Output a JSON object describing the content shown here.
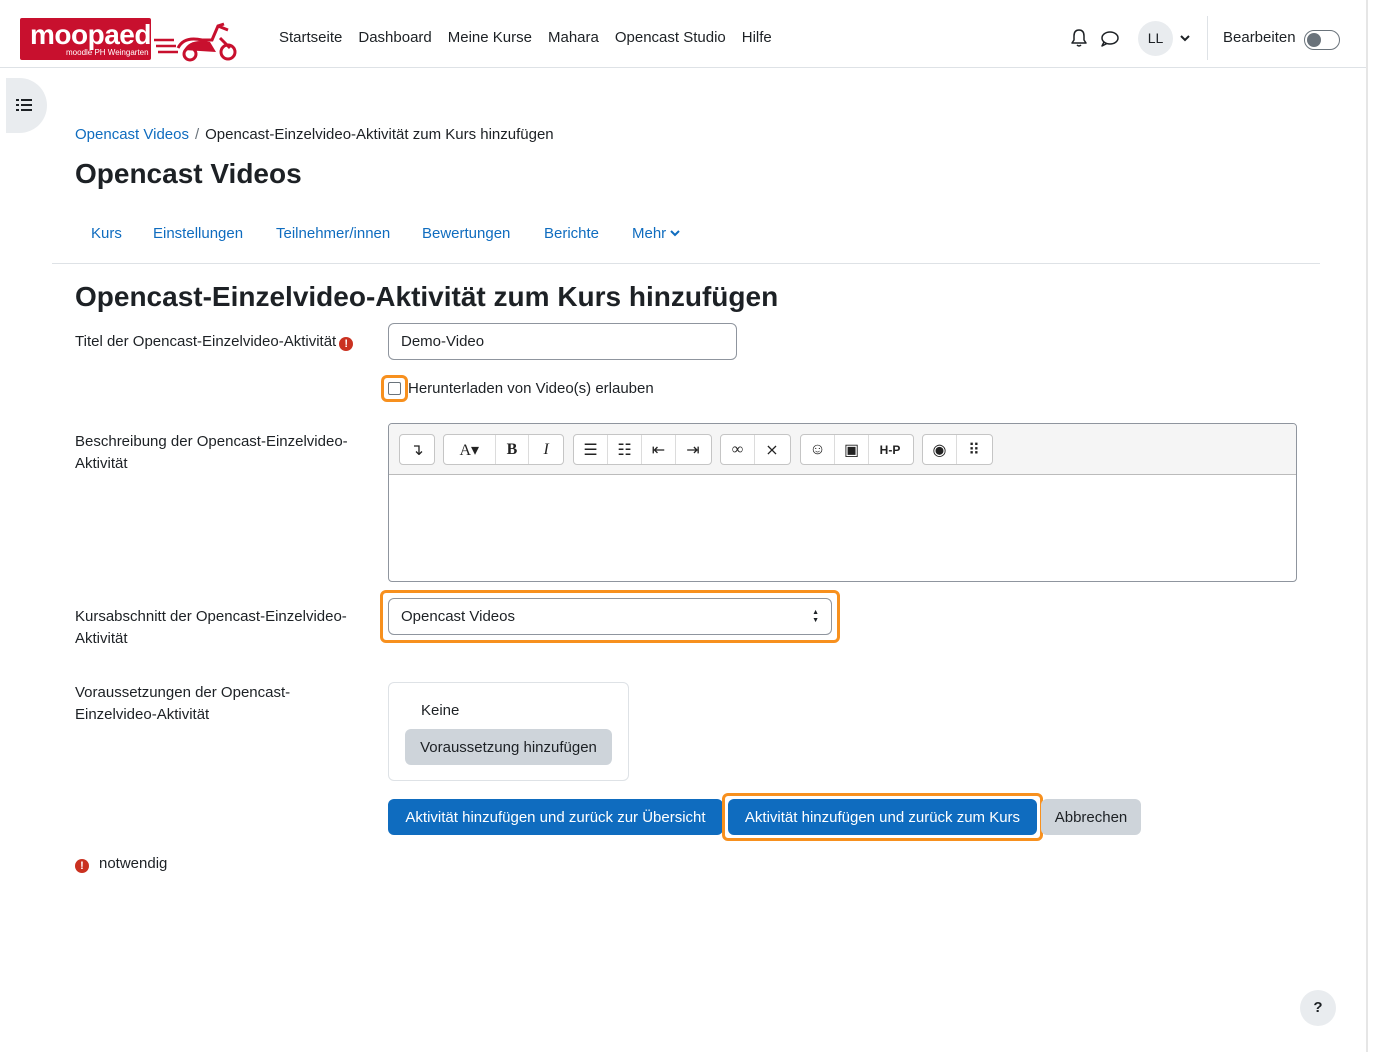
{
  "brand": {
    "logo_text": "moopaed",
    "logo_subtitle": "moodle PH Weingarten"
  },
  "navbar": {
    "items": [
      "Startseite",
      "Dashboard",
      "Meine Kurse",
      "Mahara",
      "Opencast Studio",
      "Hilfe"
    ],
    "avatar_initials": "LL",
    "edit_mode_label": "Bearbeiten",
    "edit_mode_on": false
  },
  "breadcrumb": {
    "parent": "Opencast Videos",
    "separator": "/",
    "current": "Opencast-Einzelvideo-Aktivität zum Kurs hinzufügen"
  },
  "page_title": "Opencast Videos",
  "secondary_nav": [
    "Kurs",
    "Einstellungen",
    "Teilnehmer/innen",
    "Bewertungen",
    "Berichte",
    "Mehr"
  ],
  "form": {
    "heading": "Opencast-Einzelvideo-Aktivität zum Kurs hinzufügen",
    "title_label": "Titel der Opencast-Einzelvideo-Aktivität",
    "title_value": "Demo-Video",
    "download_label": "Herunterladen von Video(s) erlauben",
    "download_checked": false,
    "description_label": "Beschreibung der Opencast-Einzelvideo-Aktivität",
    "section_label": "Kursabschnitt der Opencast-Einzelvideo-Aktivität",
    "section_value": "Opencast Videos",
    "restrictions_label": "Voraussetzungen der Opencast-Einzelvideo-Aktivität",
    "restrictions_none": "Keine",
    "add_restriction_button": "Voraussetzung hinzufügen",
    "submit_display": "Aktivität hinzufügen und zurück zur Übersicht",
    "submit_return": "Aktivität hinzufügen und zurück zum Kurs",
    "cancel": "Abbrechen",
    "required_note": "notwendig"
  },
  "editor_toolbar": {
    "h5p_label": "H-P"
  },
  "help_button": "?",
  "colors": {
    "brand_red": "#c8102e",
    "link_blue": "#0f6cbf",
    "primary_button": "#0f6cbf",
    "highlight_orange": "#f7901e",
    "required_red": "#ca3120"
  }
}
